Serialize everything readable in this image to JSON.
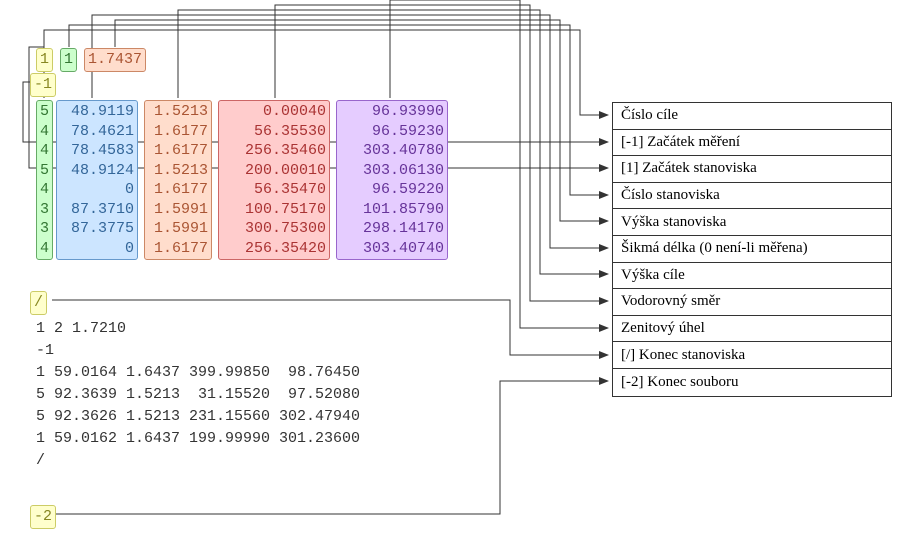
{
  "tokens": {
    "stationStart": "1",
    "stationNum": "1",
    "stationHeight": "1.7437",
    "startMeasure": "-1",
    "stationEnd": "/",
    "fileEnd": "-2"
  },
  "cols": {
    "targets": "5\n4\n4\n5\n4\n3\n3\n4",
    "slope": "48.9119\n78.4621\n78.4583\n48.9124\n0\n87.3710\n87.3775\n0",
    "theight": "1.5213\n1.6177\n1.6177\n1.5213\n1.6177\n1.5991\n1.5991\n1.6177",
    "horiz": "  0.00040\n 56.35530\n256.35460\n200.00010\n 56.35470\n100.75170\n300.75300\n256.35420",
    "zenith": " 96.93990\n 96.59230\n303.40780\n303.06130\n 96.59220\n101.85790\n298.14170\n303.40740"
  },
  "plain": "1 2 1.7210\n-1\n1 59.0164 1.6437 399.99850  98.76450\n5 92.3639 1.5213  31.15520  97.52080\n5 92.3626 1.5213 231.15560 302.47940\n1 59.0162 1.6437 199.99990 301.23600\n/",
  "legend": [
    "Číslo cíle",
    "[-1] Začátek měření",
    "[1] Začátek stanoviska",
    "Číslo stanoviska",
    "Výška stanoviska",
    "Šikmá délka (0 není-li měřena)",
    "Výška cíle",
    "Vodorovný směr",
    "Zenitový úhel",
    "[/] Konec stanoviska",
    "[-2] Konec souboru"
  ]
}
